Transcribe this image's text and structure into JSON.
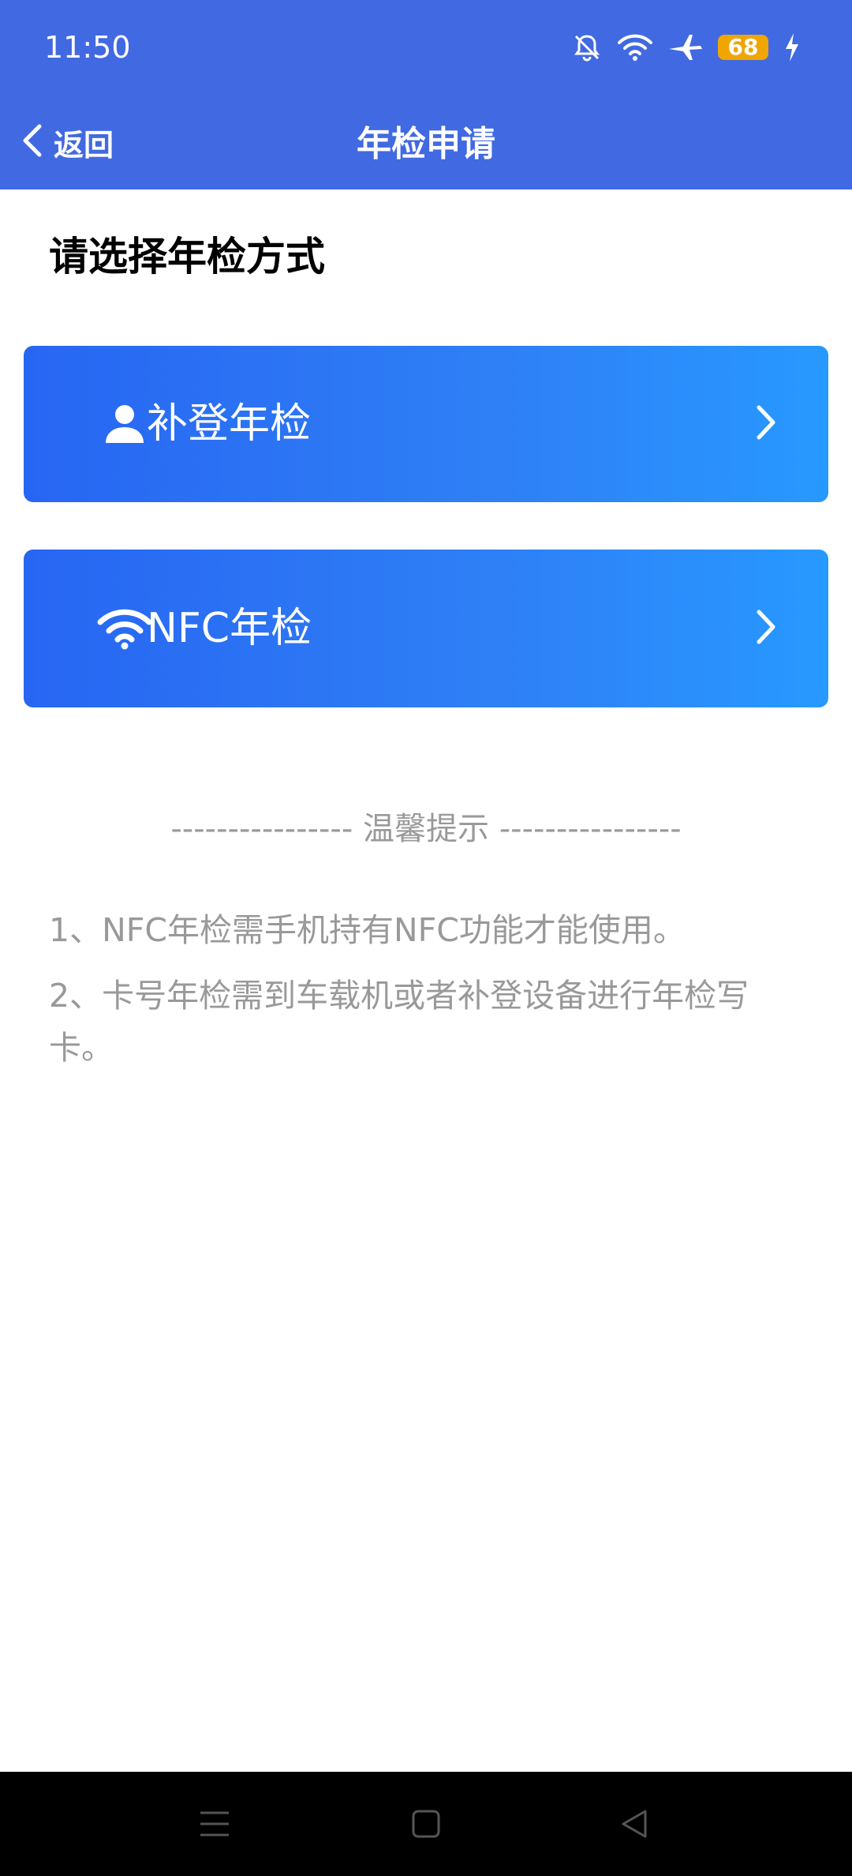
{
  "status_bar": {
    "time": "11:50",
    "battery": "68",
    "icons": [
      "bell-off-icon",
      "wifi-icon",
      "airplane-icon",
      "battery-icon",
      "charging-icon"
    ]
  },
  "nav": {
    "back_label": "返回",
    "title": "年检申请"
  },
  "main": {
    "section_title": "请选择年检方式",
    "options": [
      {
        "label": "补登年检",
        "icon": "person-icon"
      },
      {
        "label": "NFC年检",
        "icon": "wifi-icon"
      }
    ],
    "tips_header": "---------------- 温馨提示 ----------------",
    "tips": [
      "1、NFC年检需手机持有NFC功能才能使用。",
      "2、卡号年检需到车载机或者补登设备进行年检写卡。"
    ]
  },
  "colors": {
    "header": "#4169e1",
    "card_start": "#2766f2",
    "card_end": "#2799ff",
    "tip_text": "#999999"
  },
  "system_nav": {
    "icons": [
      "menu-icon",
      "home-icon",
      "back-triangle-icon"
    ]
  }
}
